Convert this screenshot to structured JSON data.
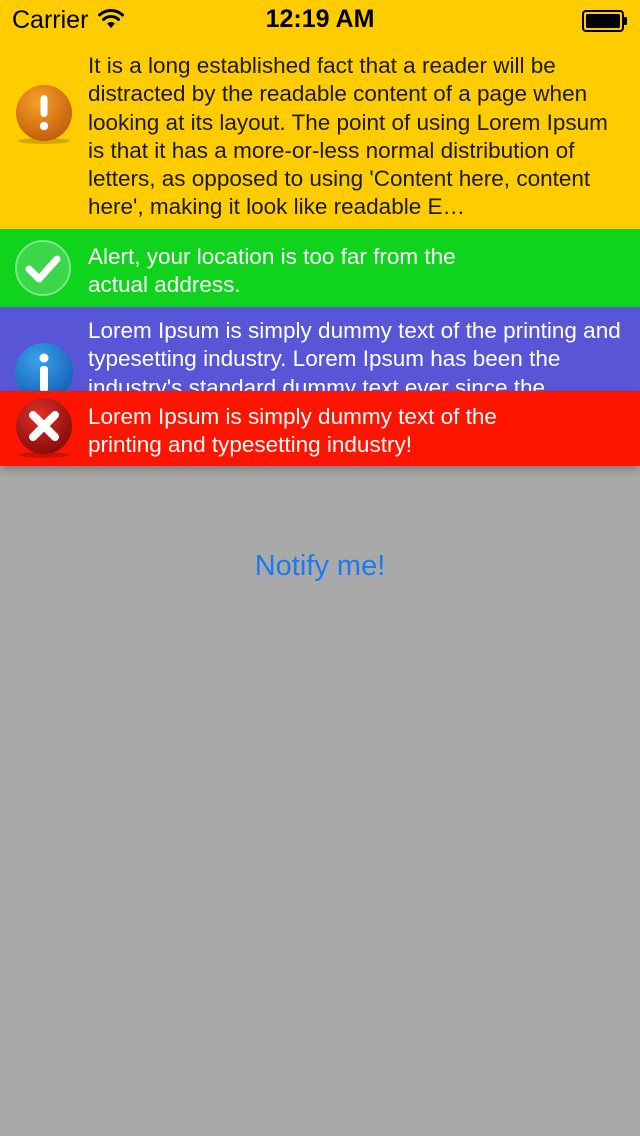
{
  "status_bar": {
    "carrier": "Carrier",
    "time": "12:19 AM",
    "icons": [
      "wifi-icon",
      "battery-icon"
    ]
  },
  "alerts": [
    {
      "type": "warning",
      "icon": "exclamation-icon",
      "color": "#ffcc00",
      "message": "It is a long established fact that a reader will be distracted by the readable content of a page when looking at its layout. The point of using Lorem Ipsum is that it has a more-or-less normal distribution of letters, as opposed to using 'Content here, content here', making it look like readable E…"
    },
    {
      "type": "success",
      "icon": "checkmark-icon",
      "color": "#0fd31c",
      "message": "Alert, your location is too far from the actual address."
    },
    {
      "type": "info",
      "icon": "info-icon",
      "color": "#5856d6",
      "message": "Lorem Ipsum is simply dummy text of the printing and typesetting industry. Lorem Ipsum has been the industry's standard dummy text ever since the"
    },
    {
      "type": "error",
      "icon": "cross-icon",
      "color": "#ff1400",
      "message": "Lorem Ipsum is simply dummy text of the printing and typesetting industry!"
    }
  ],
  "main": {
    "notify_label": "Notify me!",
    "background_color": "#a9a9a9",
    "link_color": "#1a7bf0"
  }
}
